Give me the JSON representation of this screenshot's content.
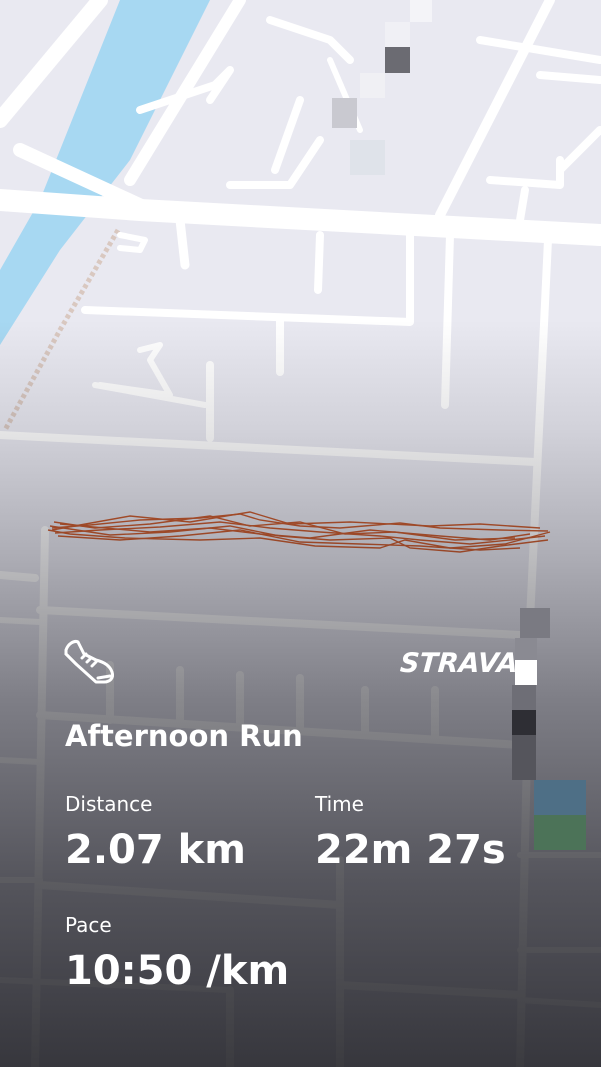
{
  "brand": {
    "logo_text": "STRAVA",
    "accent_color": "#fc4c02",
    "route_color": "#c8501e"
  },
  "activity": {
    "icon": "running-shoe-icon",
    "title": "Afternoon Run"
  },
  "stats": {
    "distance_label": "Distance",
    "distance_value": "2.07 km",
    "time_label": "Time",
    "time_value": "22m 27s",
    "pace_label": "Pace",
    "pace_value": "10:50 /km"
  },
  "map": {
    "water_color": "#a7d8f2",
    "land_color": "#e9e9f1",
    "road_color": "#ffffff"
  }
}
